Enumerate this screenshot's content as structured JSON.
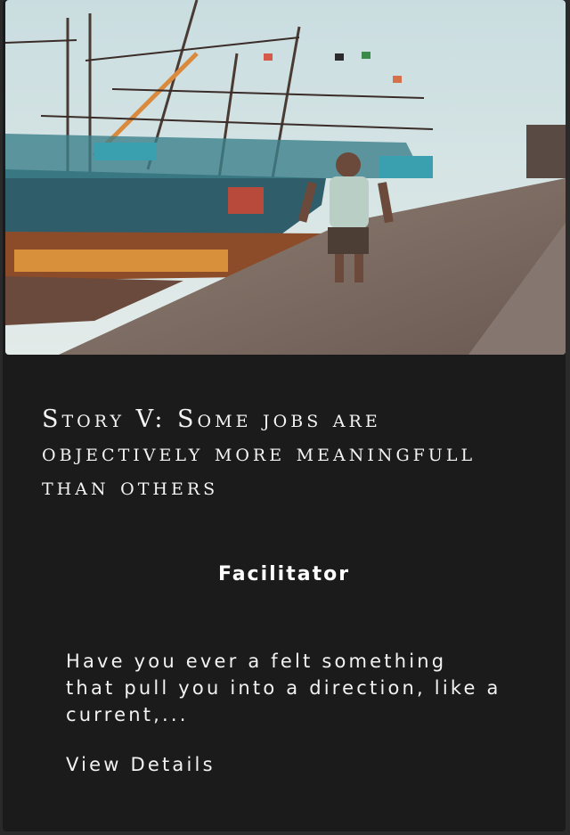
{
  "card": {
    "title": "Story V: Some jobs are objectively more meaningfull than others",
    "role": "Facilitator",
    "excerpt": "Have you ever a felt something that pull you into a direction, like a current,...",
    "view_details_label": "View Details"
  }
}
